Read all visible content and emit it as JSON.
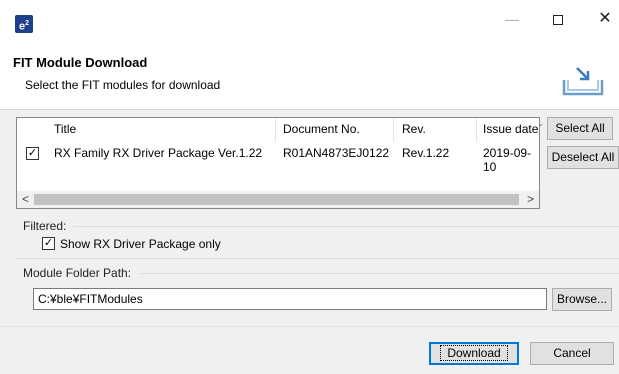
{
  "window": {
    "app_icon_text": "e",
    "app_icon_sup": "2",
    "minimize_glyph": "—",
    "close_glyph": "✕"
  },
  "header": {
    "title": "FIT Module Download",
    "description": "Select the FIT modules for download",
    "image_icon": "download-tray-icon"
  },
  "table": {
    "columns": [
      "Title",
      "Document No.",
      "Rev.",
      "Issue date"
    ],
    "rows": [
      {
        "checked": true,
        "title": "RX Family RX Driver Package Ver.1.22",
        "document_no": "R01AN4873EJ0122",
        "rev": "Rev.1.22",
        "issue_date": "2019-09-10"
      }
    ],
    "check_glyph": "✓",
    "scroll_left": "<",
    "scroll_right": ">",
    "sort_caret": "⌄"
  },
  "side_buttons": {
    "select_all": "Select All",
    "deselect_all": "Deselect All"
  },
  "filter": {
    "label": "Filtered:",
    "checkbox_label": "Show RX Driver Package only",
    "checked": true
  },
  "folder": {
    "label": "Module Folder Path:",
    "value": "C:¥ble¥FITModules",
    "browse_label": "Browse..."
  },
  "footer": {
    "download_label": "Download",
    "cancel_label": "Cancel"
  },
  "colors": {
    "accent": "#0078d7",
    "app_icon_bg": "#1f3f8a"
  }
}
